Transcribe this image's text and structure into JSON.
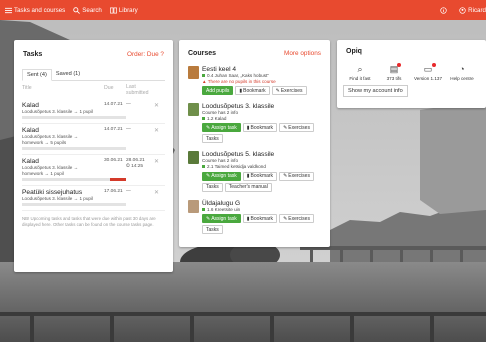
{
  "topbar": {
    "tasks_label": "Tasks and courses",
    "search_label": "Search",
    "library_label": "Library",
    "user_label": "Ricard"
  },
  "tasks": {
    "title": "Tasks",
    "order_link": "Order: Due ?",
    "tabs": [
      "Sent (4)",
      "Saved (1)"
    ],
    "columns": {
      "title": "Title",
      "due": "Due",
      "last": "Last submitted"
    },
    "rows": [
      {
        "title": "Kalad",
        "sub": "Loodusõpetus 3. klassile → 1 pupil",
        "due": "14.07.21",
        "last": "—",
        "progress": 0
      },
      {
        "title": "Kalad",
        "sub": "Loodusõpetus 3. klassile → homework → 5 pupils",
        "due": "14.07.21",
        "last": "—",
        "progress": 0
      },
      {
        "title": "Kalad",
        "sub": "Loodusõpetus 3. klassile → homework → 1 pupil",
        "due": "30.06.21",
        "last": "28.06.21 ⏲ 14:25",
        "progress": 0.15
      },
      {
        "title": "Peatüki sissejuhatus",
        "sub": "Loodusõpetus 3. klassile → 1 pupil",
        "due": "17.06.21",
        "last": "—",
        "progress": 0
      }
    ],
    "note": "NB! Upcoming tasks and tasks that were due within past 30 days are displayed here. Other tasks can be found on the course tasks page."
  },
  "courses": {
    "title": "Courses",
    "more_link": "More options",
    "items": [
      {
        "title": "Eesti keel 4",
        "meta": "0.4 Juhan Saar, „Kaks hobust”",
        "warn": "There are no pupils in this course",
        "buttons": [
          "Add pupils",
          "Bookmark",
          "Exercises"
        ],
        "thumb_color": "#b97b3d"
      },
      {
        "title": "Loodusõpetus 3. klassile",
        "meta1": "Course has 2 info",
        "meta2": "1.2 Kalad",
        "buttons": [
          "Assign task",
          "Bookmark",
          "Exercises",
          "Tasks"
        ],
        "thumb_color": "#6f8f4a"
      },
      {
        "title": "Loodusõpetus 5. klassile",
        "meta1": "Course has 2 info",
        "meta2": "2.1 Taimed ketsidja valdkond",
        "buttons": [
          "Assign task",
          "Bookmark",
          "Exercises",
          "Tasks",
          "Teacher's manual"
        ],
        "thumb_color": "#5a7a3a"
      },
      {
        "title": "Üldajalugu G",
        "meta2": "1.6 Kreetsite uin",
        "buttons": [
          "Assign task",
          "Bookmark",
          "Exercises",
          "Tasks"
        ],
        "thumb_color": "#b99a7a"
      }
    ]
  },
  "opiq": {
    "title": "Opiq",
    "icons": [
      {
        "label": "Find it fast",
        "icon": "search-icon"
      },
      {
        "label": "373 tifs",
        "icon": "tips-icon"
      },
      {
        "label": "Version 1.137",
        "icon": "version-icon"
      },
      {
        "label": "Help centre",
        "icon": "help-chat-icon"
      }
    ],
    "account_button": "Show my account info"
  },
  "colors": {
    "accent": "#e84a2f",
    "green": "#4aa83e",
    "danger": "#d43a2a"
  }
}
